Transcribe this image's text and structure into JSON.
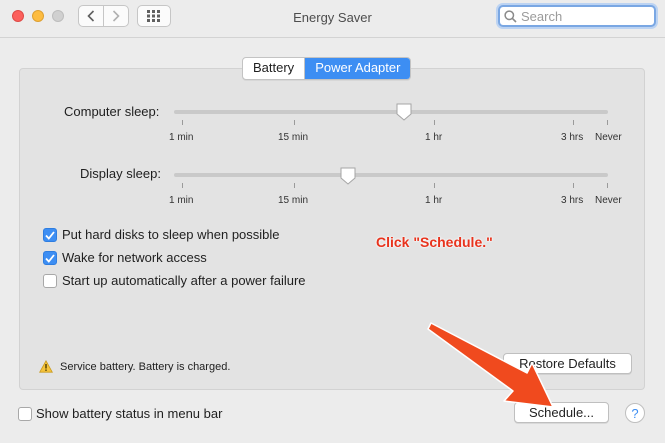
{
  "window": {
    "title": "Energy Saver"
  },
  "search": {
    "placeholder": "Search"
  },
  "tabs": [
    {
      "label": "Battery",
      "selected": false
    },
    {
      "label": "Power Adapter",
      "selected": true
    }
  ],
  "computer_sleep": {
    "label": "Computer sleep:",
    "position_fraction": 0.53,
    "ticks": [
      "1 min",
      "15 min",
      "1 hr",
      "3 hrs",
      "Never"
    ]
  },
  "display_sleep": {
    "label": "Display sleep:",
    "position_fraction": 0.4,
    "ticks": [
      "1 min",
      "15 min",
      "1 hr",
      "3 hrs",
      "Never"
    ]
  },
  "options": [
    {
      "label": "Put hard disks to sleep when possible",
      "checked": true
    },
    {
      "label": "Wake for network access",
      "checked": true
    },
    {
      "label": "Start up automatically after a power failure",
      "checked": false
    }
  ],
  "status": {
    "text": "Service battery. Battery is charged."
  },
  "buttons": {
    "restore_defaults": "Restore Defaults",
    "schedule": "Schedule...",
    "help": "?"
  },
  "menu_bar_option": {
    "label": "Show battery status in menu bar",
    "checked": false
  },
  "annotation": {
    "text": "Click \"Schedule.\"",
    "color": "#e8331d"
  },
  "colors": {
    "accent": "#3d8ef3",
    "annotation": "#e8331d"
  }
}
